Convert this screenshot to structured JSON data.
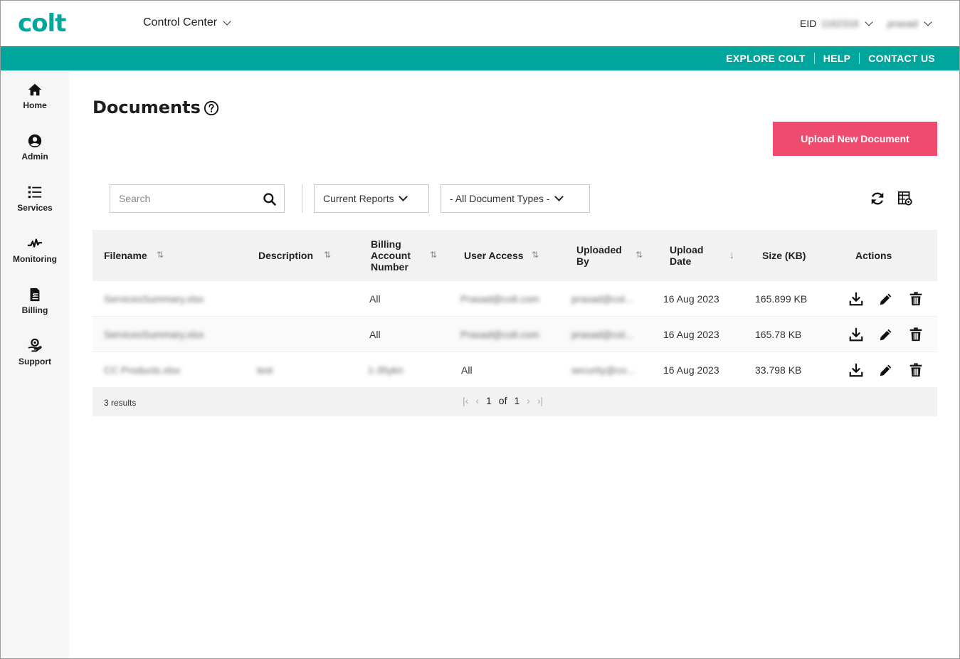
{
  "header": {
    "logo": "colt",
    "app_switcher": "Control Center",
    "eid_label": "EID",
    "eid_value": "1162316",
    "user": "prasad"
  },
  "top_links": [
    "EXPLORE COLT",
    "HELP",
    "CONTACT US"
  ],
  "sidebar": {
    "items": [
      {
        "label": "Home",
        "icon": "home-icon"
      },
      {
        "label": "Admin",
        "icon": "user-icon"
      },
      {
        "label": "Services",
        "icon": "list-icon"
      },
      {
        "label": "Monitoring",
        "icon": "pulse-icon"
      },
      {
        "label": "Billing",
        "icon": "invoice-icon"
      },
      {
        "label": "Support",
        "icon": "support-icon"
      }
    ]
  },
  "page": {
    "title": "Documents",
    "upload_button": "Upload New Document"
  },
  "filters": {
    "search_placeholder": "Search",
    "reports": "Current Reports",
    "doc_types": "- All Document Types -"
  },
  "table": {
    "headers": {
      "filename": "Filename",
      "description": "Description",
      "billing1": "Billing",
      "billing2": "Account",
      "billing3": "Number",
      "user_access": "User Access",
      "uploaded1": "Uploaded",
      "uploaded2": "By",
      "upload_date1": "Upload",
      "upload_date2": "Date",
      "size": "Size (KB)",
      "actions": "Actions"
    },
    "rows": [
      {
        "filename": "ServicesSummary.xlsx",
        "description": "",
        "billing": "All",
        "user_access": "Prasad@colt.com",
        "uploaded_by": "prasad@col...",
        "date": "16 Aug 2023",
        "size": "165.899 KB"
      },
      {
        "filename": "ServicesSummary.xlsx",
        "description": "",
        "billing": "All",
        "user_access": "Prasad@colt.com",
        "uploaded_by": "prasad@col...",
        "date": "16 Aug 2023",
        "size": "165.78 KB"
      },
      {
        "filename": "CC Products.xlsx",
        "description": "test",
        "billing": "1-35ykn",
        "user_access": "All",
        "uploaded_by": "security@co...",
        "date": "16 Aug 2023",
        "size": "33.798 KB"
      }
    ],
    "footer": {
      "results": "3 results",
      "page": "1",
      "of": "of",
      "total": "1"
    }
  },
  "colors": {
    "brand": "#00a59b",
    "accent": "#ef4b6f"
  }
}
